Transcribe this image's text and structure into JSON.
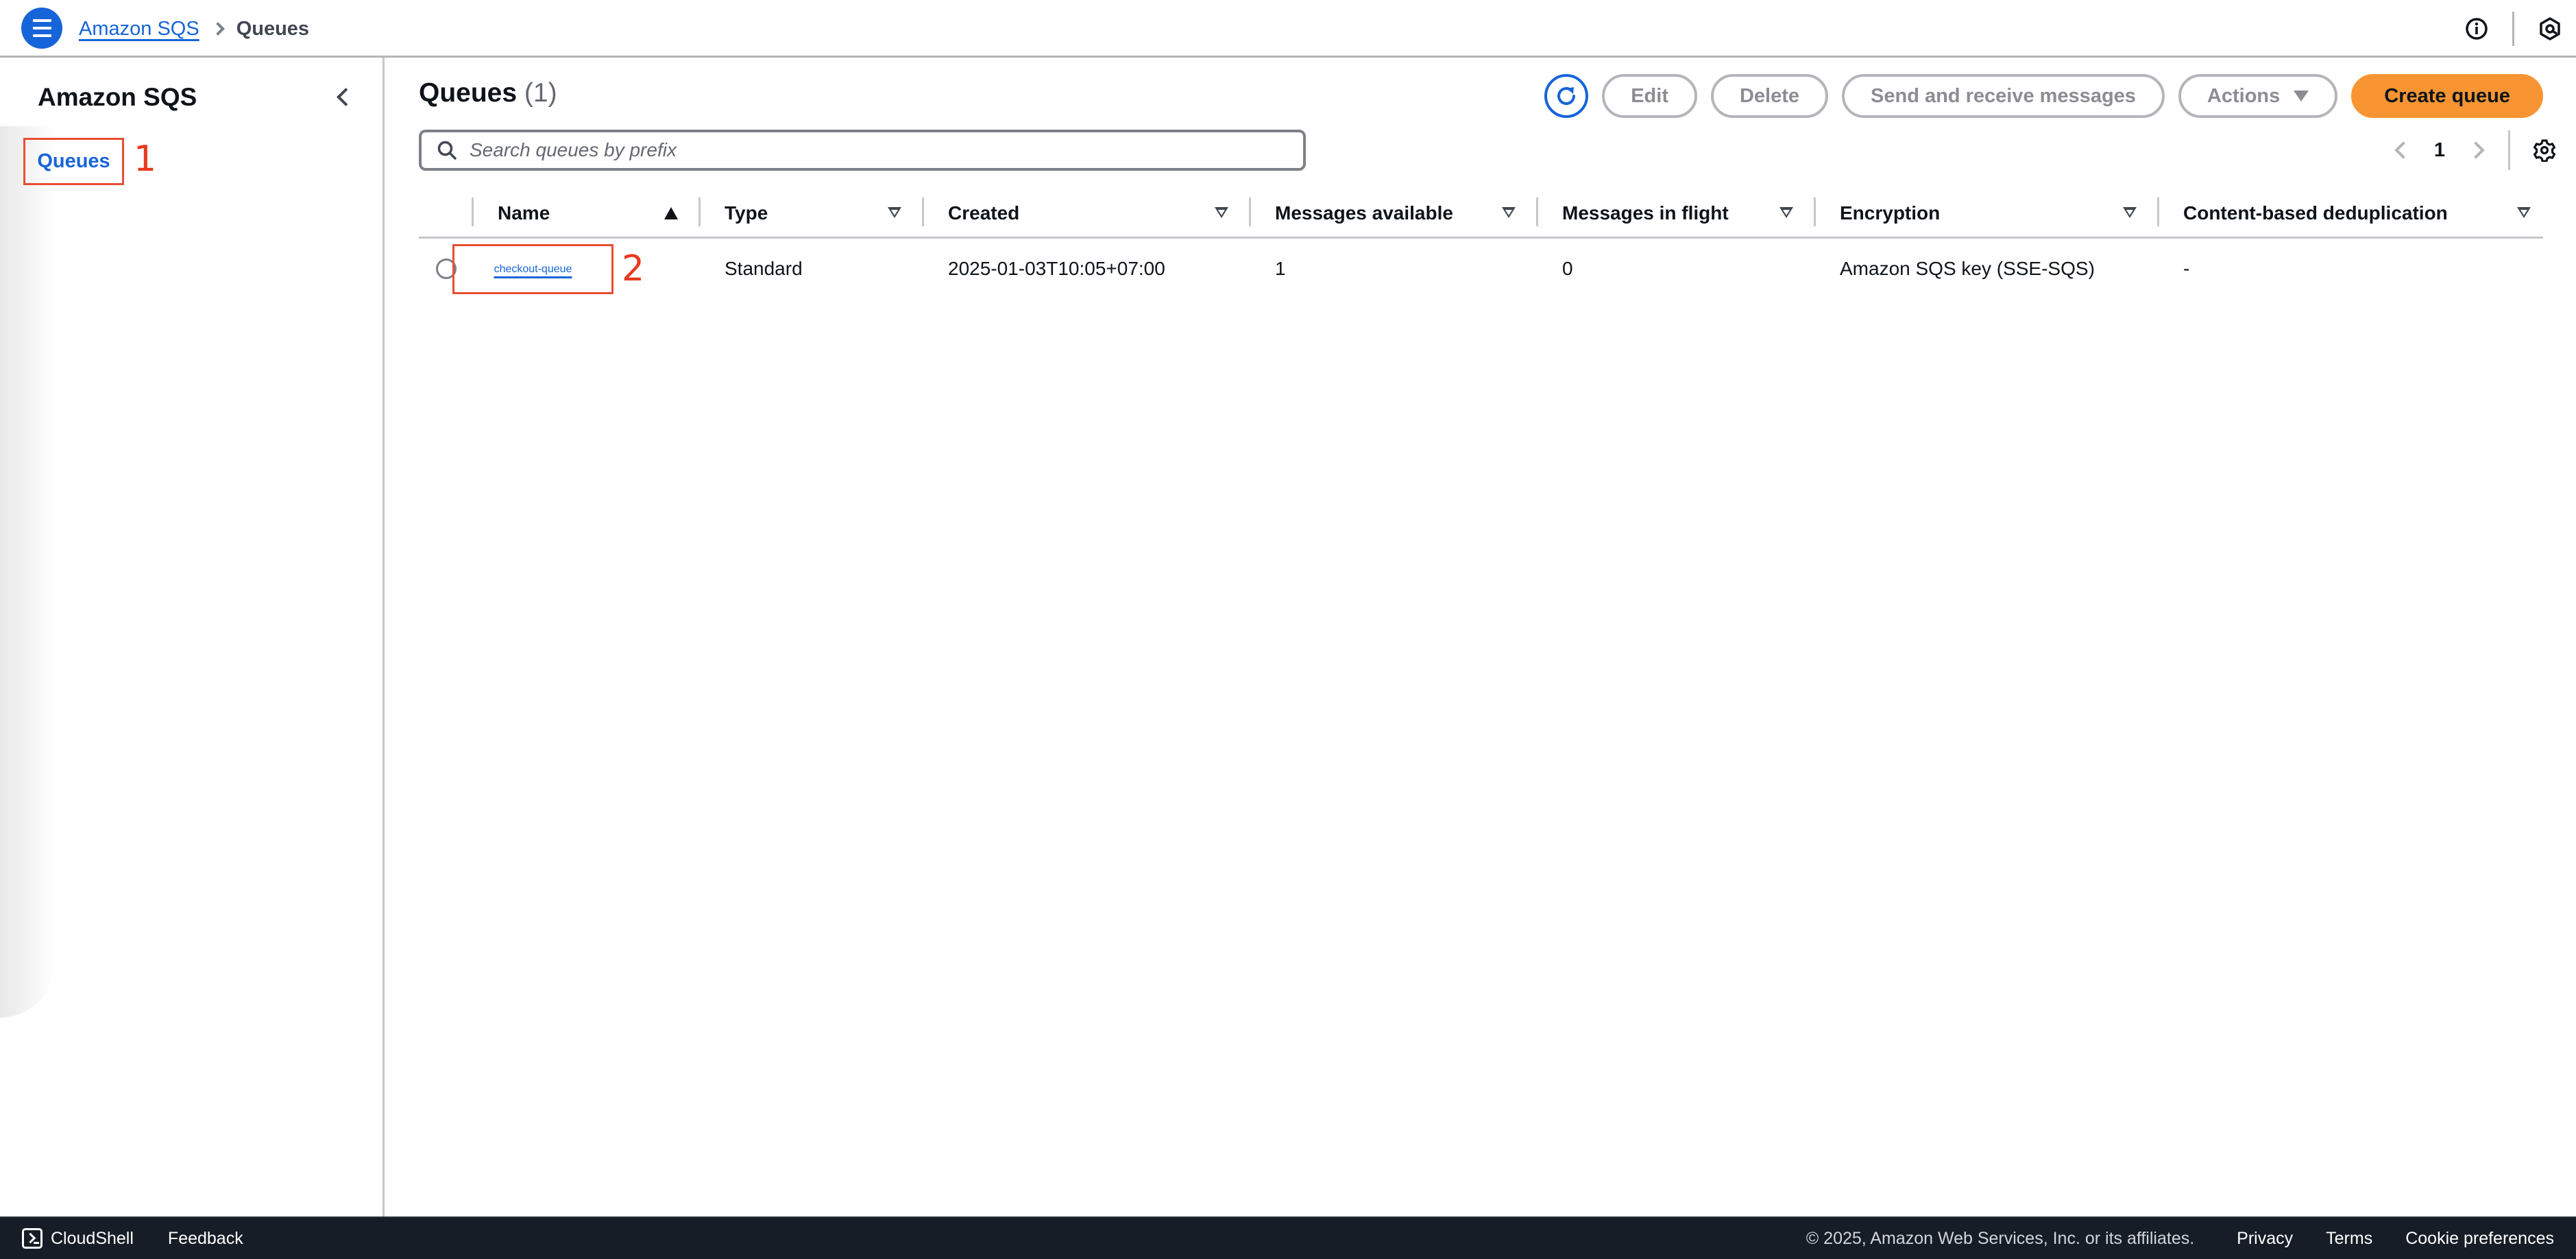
{
  "topbar": {
    "menu_icon": "hamburger-menu-icon",
    "breadcrumb": [
      {
        "label": "Amazon SQS",
        "link": true
      },
      {
        "label": "Queues",
        "link": false
      }
    ],
    "icons": [
      "info-icon",
      "settings-hexagon-icon"
    ]
  },
  "sidebar": {
    "title": "Amazon SQS",
    "collapse_icon": "chevron-left-icon",
    "items": [
      {
        "label": "Queues",
        "active": true,
        "annotation": "1"
      }
    ]
  },
  "main": {
    "title": "Queues",
    "count": "(1)",
    "toolbar": {
      "refresh_icon": "refresh-icon",
      "edit_label": "Edit",
      "delete_label": "Delete",
      "send_receive_label": "Send and receive messages",
      "actions_label": "Actions",
      "create_label": "Create queue"
    },
    "search": {
      "placeholder": "Search queues by prefix",
      "value": ""
    },
    "pagination": {
      "current_page": "1",
      "settings_icon": "gear-icon"
    },
    "table": {
      "columns": [
        {
          "label": "Name",
          "sort": "ascending"
        },
        {
          "label": "Type",
          "sort": "none"
        },
        {
          "label": "Created",
          "sort": "none"
        },
        {
          "label": "Messages available",
          "sort": "none"
        },
        {
          "label": "Messages in flight",
          "sort": "none"
        },
        {
          "label": "Encryption",
          "sort": "none"
        },
        {
          "label": "Content-based deduplication",
          "sort": "none"
        }
      ],
      "rows": [
        {
          "selected": false,
          "name": "checkout-queue",
          "annotation": "2",
          "type": "Standard",
          "created": "2025-01-03T10:05+07:00",
          "messages_available": "1",
          "messages_in_flight": "0",
          "encryption": "Amazon SQS key (SSE-SQS)",
          "content_based_dedup": "-"
        }
      ]
    }
  },
  "footer": {
    "cloudshell_label": "CloudShell",
    "feedback_label": "Feedback",
    "copyright": "© 2025, Amazon Web Services, Inc. or its affiliates.",
    "links": [
      "Privacy",
      "Terms",
      "Cookie preferences"
    ]
  },
  "colors": {
    "primary_blue": "#1664d9",
    "create_button_orange": "#f89532",
    "annotation_red": "#e94e35",
    "footer_bg": "#161d26"
  }
}
